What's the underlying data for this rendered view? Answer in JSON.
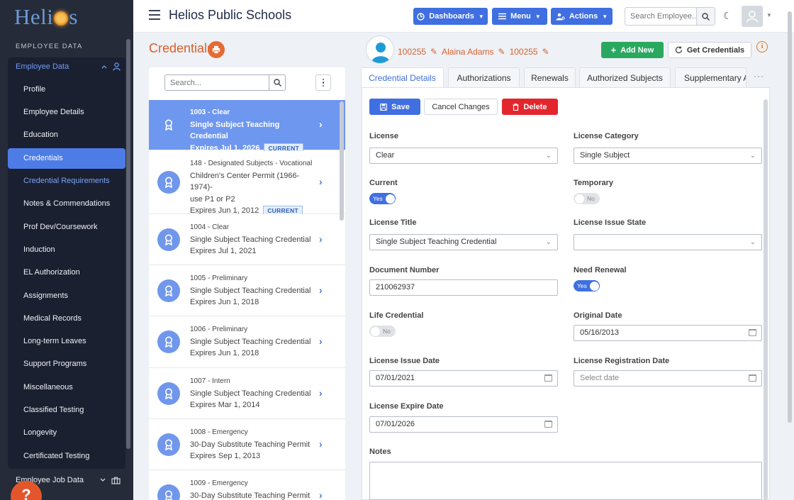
{
  "brand": {
    "logo_left": "Heli",
    "logo_right": "s"
  },
  "sidebar": {
    "section": "EMPLOYEE DATA",
    "group_label": "Employee Data",
    "items": [
      {
        "label": "Profile"
      },
      {
        "label": "Employee Details"
      },
      {
        "label": "Education"
      },
      {
        "label": "Credentials"
      },
      {
        "label": "Credential Requirements"
      },
      {
        "label": "Notes & Commendations"
      },
      {
        "label": "Prof Dev/Coursework"
      },
      {
        "label": "Induction"
      },
      {
        "label": "EL Authorization"
      },
      {
        "label": "Assignments"
      },
      {
        "label": "Medical Records"
      },
      {
        "label": "Long-term Leaves"
      },
      {
        "label": "Support Programs"
      },
      {
        "label": "Miscellaneous"
      },
      {
        "label": "Classified Testing"
      },
      {
        "label": "Longevity"
      },
      {
        "label": "Certificated Testing"
      }
    ],
    "footer_label": "Employee Job Data",
    "help": "?"
  },
  "topbar": {
    "title": "Helios Public Schools",
    "dashboards": "Dashboards",
    "menu": "Menu",
    "actions": "Actions",
    "search_placeholder": "Search Employee..."
  },
  "page": {
    "title": "Credentials",
    "employee": {
      "id": "100255",
      "name": "Alaina Adams",
      "id2": "100255"
    },
    "add_new": "Add New",
    "get_credentials": "Get Credentials",
    "info": "i"
  },
  "list": {
    "search_placeholder": "Search...",
    "items": [
      {
        "line1": "1003 - Clear",
        "line2": "Single Subject Teaching Credential",
        "line3": "Expires Jul 1, 2026",
        "badge": "CURRENT"
      },
      {
        "line1": "148 - Designated Subjects - Vocational",
        "line2": "Children's Center Permit (1966-1974)-",
        "line3": "use P1 or P2",
        "line4": "Expires Jun 1, 2012",
        "badge": "CURRENT"
      },
      {
        "line1": "1004 - Clear",
        "line2": "Single Subject Teaching Credential",
        "line3": "Expires Jul 1, 2021"
      },
      {
        "line1": "1005 - Preliminary",
        "line2": "Single Subject Teaching Credential",
        "line3": "Expires Jun 1, 2018"
      },
      {
        "line1": "1006 - Preliminary",
        "line2": "Single Subject Teaching Credential",
        "line3": "Expires Jun 1, 2018"
      },
      {
        "line1": "1007 - Intern",
        "line2": "Single Subject Teaching Credential",
        "line3": "Expires Mar 1, 2014"
      },
      {
        "line1": "1008 - Emergency",
        "line2": "30-Day Substitute Teaching Permit",
        "line3": "Expires Sep 1, 2013"
      },
      {
        "line1": "1009 - Emergency",
        "line2": "30-Day Substitute Teaching Permit",
        "line3": ""
      }
    ]
  },
  "tabs": [
    "Credential Details",
    "Authorizations",
    "Renewals",
    "Authorized Subjects",
    "Supplementary A"
  ],
  "tab_more": "···",
  "form": {
    "save": "Save",
    "cancel": "Cancel Changes",
    "delete": "Delete",
    "license_label": "License",
    "license_value": "Clear",
    "license_category_label": "License Category",
    "license_category_value": "Single Subject",
    "current_label": "Current",
    "current_value": "Yes",
    "temporary_label": "Temporary",
    "temporary_value": "No",
    "license_title_label": "License Title",
    "license_title_value": "Single Subject Teaching Credential",
    "license_issue_state_label": "License Issue State",
    "license_issue_state_value": "",
    "document_number_label": "Document Number",
    "document_number_value": "210062937",
    "need_renewal_label": "Need Renewal",
    "need_renewal_value": "Yes",
    "life_credential_label": "Life Credential",
    "life_credential_value": "No",
    "original_date_label": "Original Date",
    "original_date_value": "05/16/2013",
    "license_issue_date_label": "License Issue Date",
    "license_issue_date_value": "07/01/2021",
    "license_registration_date_label": "License Registration Date",
    "license_registration_date_placeholder": "Select date",
    "license_expire_date_label": "License Expire Date",
    "license_expire_date_value": "07/01/2026",
    "notes_label": "Notes"
  }
}
